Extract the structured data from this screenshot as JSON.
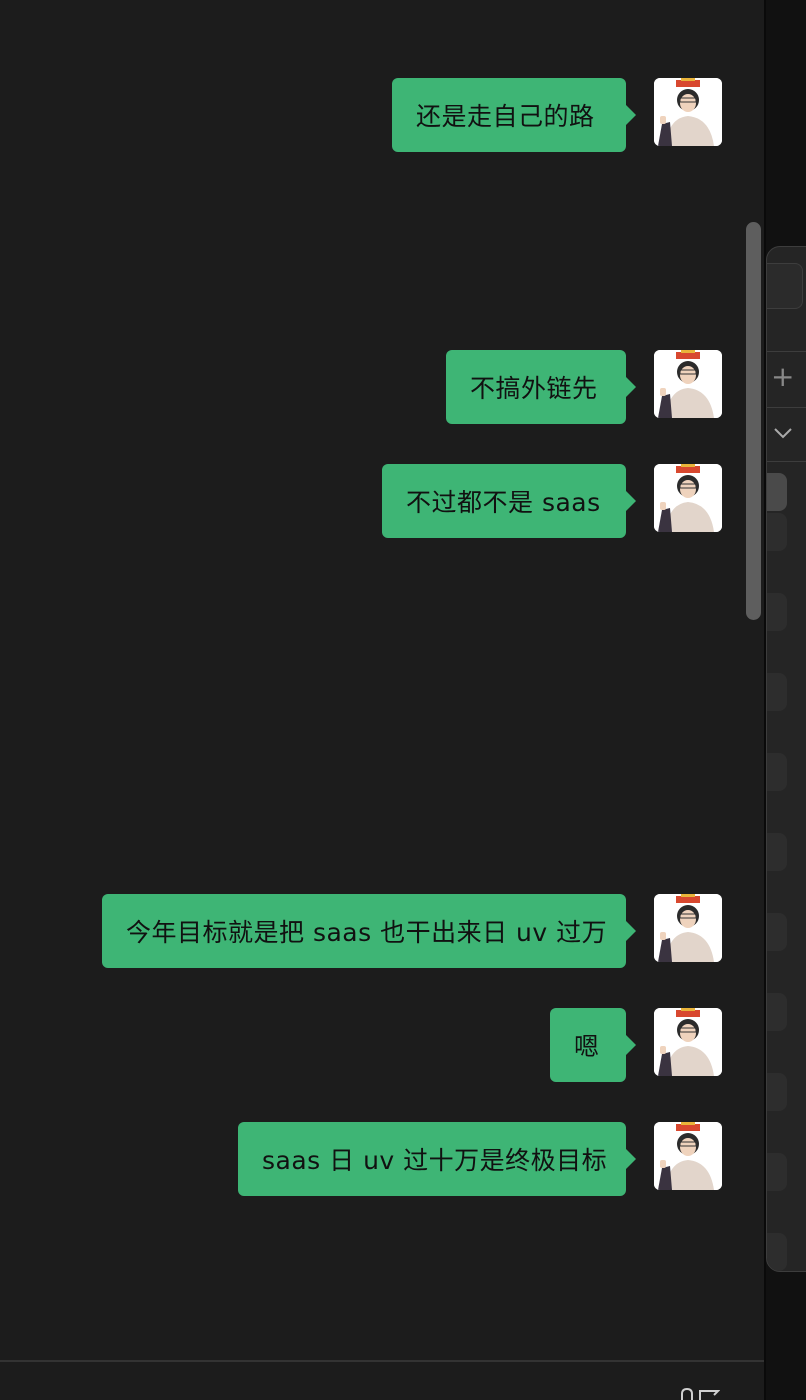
{
  "conversation": {
    "messages": [
      {
        "text": "还是走自己的路"
      },
      {
        "text": "不搞外链先"
      },
      {
        "text": "不过都不是 saas"
      },
      {
        "text": "今年目标就是把 saas 也干出来日 uv 过万"
      },
      {
        "text": "嗯"
      },
      {
        "text": "saas 日 uv 过十万是终极目标"
      }
    ]
  },
  "side_panel": {
    "add_icon": "+"
  },
  "colors": {
    "bubble": "#3eb575",
    "chat_background": "#1c1c1c",
    "scrollbar": "#5e5e5e"
  }
}
